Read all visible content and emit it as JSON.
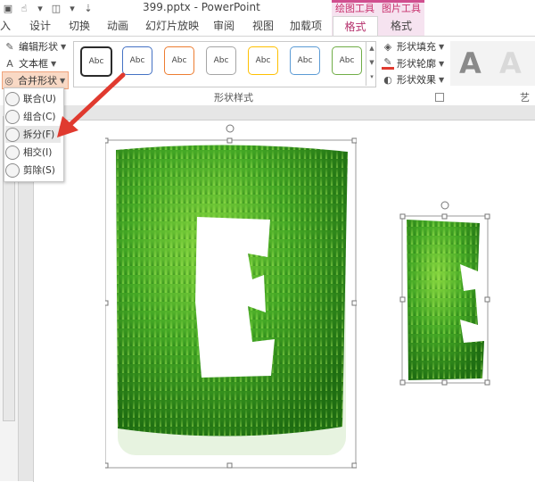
{
  "window": {
    "title": "399.pptx - PowerPoint"
  },
  "context_tabs": {
    "drawing_tools": "绘图工具",
    "picture_tools": "图片工具"
  },
  "tabs": [
    {
      "label": "入"
    },
    {
      "label": "设计"
    },
    {
      "label": "切换"
    },
    {
      "label": "动画"
    },
    {
      "label": "幻灯片放映"
    },
    {
      "label": "审阅"
    },
    {
      "label": "视图"
    },
    {
      "label": "加载项"
    },
    {
      "label": "格式"
    },
    {
      "label": "格式"
    }
  ],
  "ribbon": {
    "insert_shapes": {
      "edit_shape": "编辑形状",
      "text_box": "文本框",
      "merge_shapes": "合并形状"
    },
    "shape_styles": {
      "group_label": "形状样式",
      "swatches": [
        {
          "label": "Abc",
          "border": "#2b2b2b"
        },
        {
          "label": "Abc",
          "border": "#4472c4"
        },
        {
          "label": "Abc",
          "border": "#ed7d31"
        },
        {
          "label": "Abc",
          "border": "#a5a5a5"
        },
        {
          "label": "Abc",
          "border": "#ffc000"
        },
        {
          "label": "Abc",
          "border": "#5b9bd5"
        },
        {
          "label": "Abc",
          "border": "#70ad47"
        }
      ],
      "fill": "形状填充",
      "outline": "形状轮廓",
      "effects": "形状效果"
    },
    "wordart": {
      "group_label": "艺",
      "letters": [
        "A",
        "A"
      ]
    }
  },
  "merge_menu": {
    "items": [
      {
        "label": "联合(U)"
      },
      {
        "label": "组合(C)"
      },
      {
        "label": "拆分(F)"
      },
      {
        "label": "相交(I)"
      },
      {
        "label": "剪除(S)"
      }
    ]
  },
  "colors": {
    "accent": "#c8326e",
    "arrow": "#e03a2f",
    "grass": "#3f9f22"
  }
}
